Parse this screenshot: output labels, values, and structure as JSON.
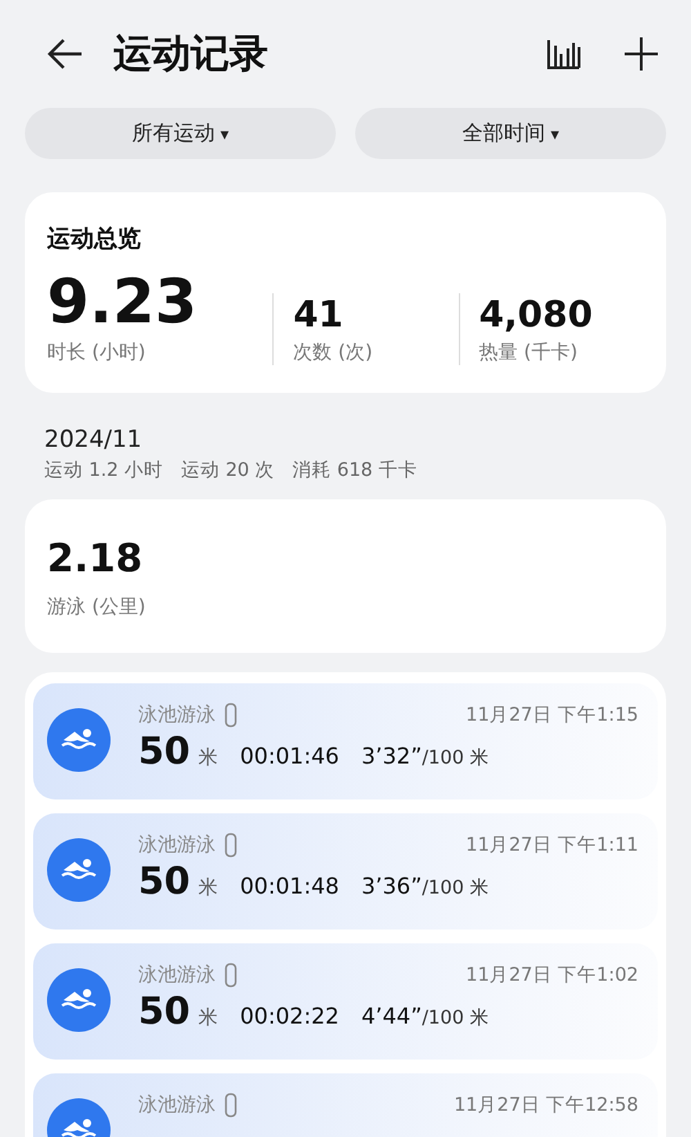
{
  "header": {
    "title": "运动记录"
  },
  "filters": [
    {
      "label": "所有运动",
      "caret": "▾"
    },
    {
      "label": "全部时间",
      "caret": "▾"
    }
  ],
  "overview": {
    "title": "运动总览",
    "stats": [
      {
        "value": "9.23",
        "label": "时长 (小时)",
        "kind": "big"
      },
      {
        "value": "41",
        "label": "次数 (次)",
        "kind": "small"
      },
      {
        "value": "4,080",
        "label": "热量 (千卡)",
        "kind": "small"
      }
    ]
  },
  "month": {
    "title": "2024/11",
    "summary": "运动 1.2 小时   运动 20 次   消耗 618 千卡"
  },
  "month_card": {
    "value": "2.18",
    "label": "游泳 (公里)"
  },
  "records": [
    {
      "name": "泳池游泳",
      "time": "11月27日 下午1:15",
      "distance": "50",
      "unit": "米",
      "duration": "00:01:46",
      "pace": "3’32”",
      "pace_unit": "/100 米"
    },
    {
      "name": "泳池游泳",
      "time": "11月27日 下午1:11",
      "distance": "50",
      "unit": "米",
      "duration": "00:01:48",
      "pace": "3’36”",
      "pace_unit": "/100 米"
    },
    {
      "name": "泳池游泳",
      "time": "11月27日 下午1:02",
      "distance": "50",
      "unit": "米",
      "duration": "00:02:22",
      "pace": "4’44”",
      "pace_unit": "/100 米"
    },
    {
      "name": "泳池游泳",
      "time": "11月27日 下午12:58"
    }
  ]
}
